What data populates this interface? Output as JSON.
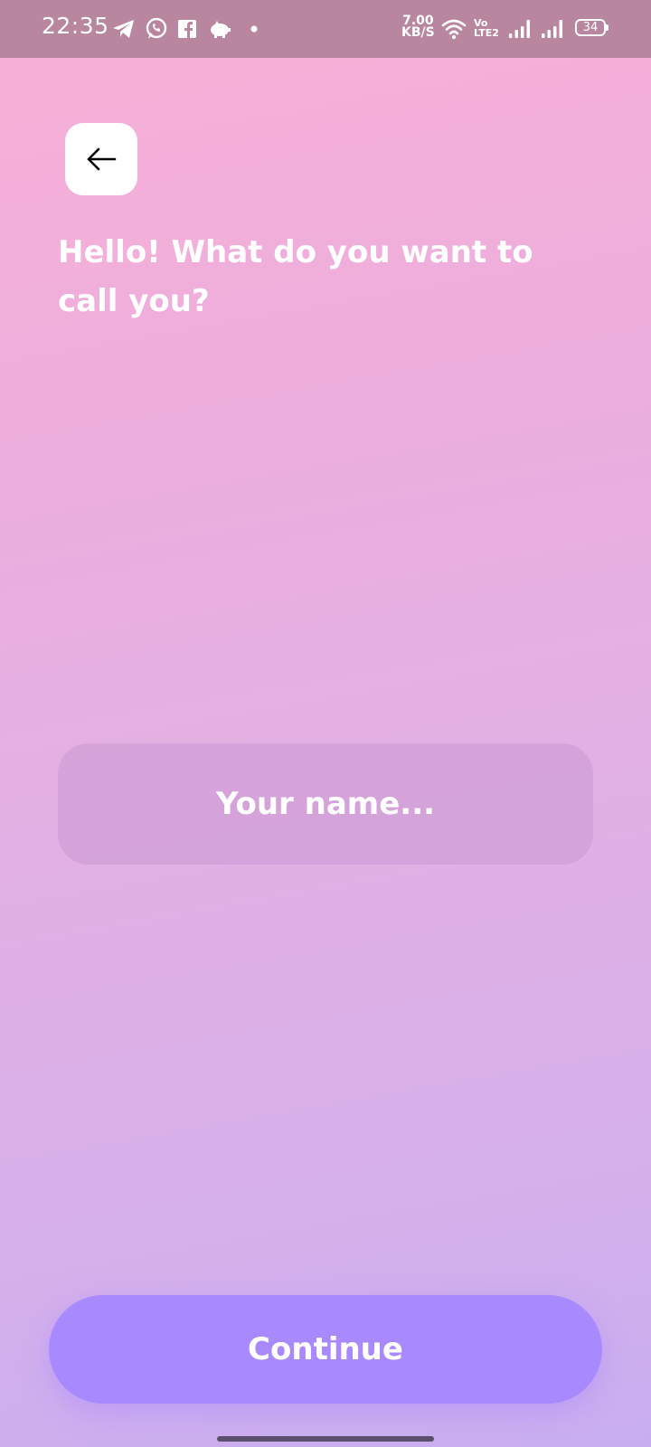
{
  "status_bar": {
    "time": "22:35",
    "net_speed_value": "7.00",
    "net_speed_unit": "KB/S",
    "volte_top": "Vo",
    "volte_bottom": "LTE2",
    "battery": "34",
    "icons": [
      "telegram-icon",
      "whatsapp-icon",
      "facebook-icon",
      "piggy-bank-icon",
      "dot-icon",
      "wifi-icon",
      "signal-icon",
      "signal-icon-2"
    ]
  },
  "screen": {
    "back_icon": "arrow-left-icon",
    "title": "Hello! What do you want to call you?",
    "name_input": {
      "placeholder": "Your name...",
      "value": ""
    },
    "continue_label": "Continue"
  },
  "colors": {
    "accent": "#a98afe",
    "gradient_top": "#f8b0d6",
    "gradient_bottom": "#c8aef0",
    "status_bar": "#b9869f"
  }
}
